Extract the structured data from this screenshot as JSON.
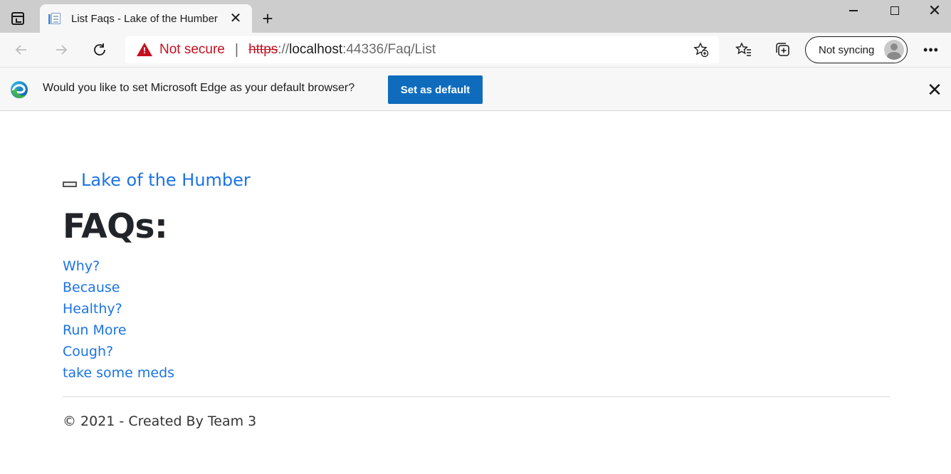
{
  "browser": {
    "tab": {
      "title": "List Faqs - Lake of the Humber"
    },
    "address": {
      "security_label": "Not secure",
      "separator": "|",
      "scheme": "https",
      "scheme_sep": "://",
      "host": "localhost",
      "rest": ":44336/Faq/List"
    },
    "profile": {
      "label": "Not syncing"
    },
    "more_label": "•••"
  },
  "infobar": {
    "message": "Would you like to set Microsoft Edge as your default browser?",
    "button_label": "Set as default"
  },
  "page": {
    "brand": "Lake of the Humber",
    "title": "FAQs:",
    "faqs": [
      "Why?",
      "Because",
      "Healthy?",
      "Run More",
      "Cough?",
      "take some meds"
    ],
    "footer": "© 2021 - Created By Team 3"
  },
  "colors": {
    "link": "#1b74e4",
    "danger": "#c50f1f",
    "primary_button": "#0f6cbd"
  }
}
